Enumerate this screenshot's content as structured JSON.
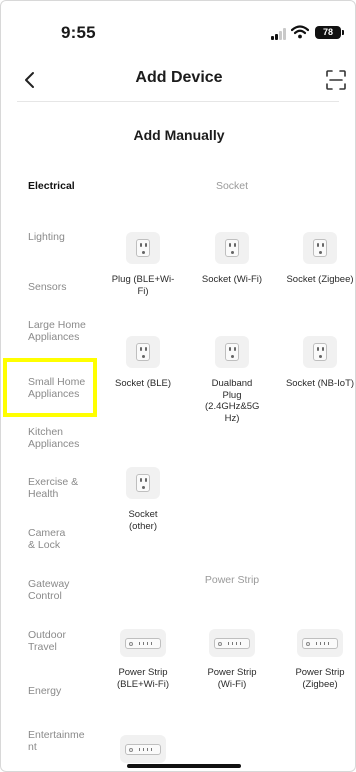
{
  "status_bar": {
    "time": "9:55",
    "battery": "78"
  },
  "header": {
    "title": "Add Device",
    "back_icon": "chevron-left-icon",
    "scan_icon": "scan-icon"
  },
  "section_title": "Add Manually",
  "categories": [
    {
      "label": "Electrical",
      "active": true
    },
    {
      "label": "Lighting"
    },
    {
      "label": "Sensors"
    },
    {
      "label": "Large Home Appliances"
    },
    {
      "label": "Small Home Appliances"
    },
    {
      "label": "Kitchen Appliances"
    },
    {
      "label": "Exercise & Health"
    },
    {
      "label": "Camera & Lock"
    },
    {
      "label": "Gateway Control"
    },
    {
      "label": "Outdoor Travel"
    },
    {
      "label": "Energy"
    },
    {
      "label": "Entertainment"
    }
  ],
  "groups": {
    "socket": {
      "label": "Socket",
      "devices": [
        {
          "name": "Plug (BLE+Wi-Fi)"
        },
        {
          "name": "Socket (Wi-Fi)"
        },
        {
          "name": "Socket (Zigbee)"
        },
        {
          "name": "Socket (BLE)"
        },
        {
          "name": "Dualband Plug (2.4GHz&5G Hz)"
        },
        {
          "name": "Socket (NB-IoT)"
        },
        {
          "name": "Socket (other)"
        }
      ]
    },
    "power_strip": {
      "label": "Power Strip",
      "devices": [
        {
          "name": "Power Strip (BLE+Wi-Fi)"
        },
        {
          "name": "Power Strip (Wi-Fi)"
        },
        {
          "name": "Power Strip (Zigbee)"
        },
        {
          "name": ""
        }
      ]
    }
  },
  "colors": {
    "highlight": "#ffff00",
    "active_text": "#111111",
    "inactive_text": "#8a8a8a"
  }
}
